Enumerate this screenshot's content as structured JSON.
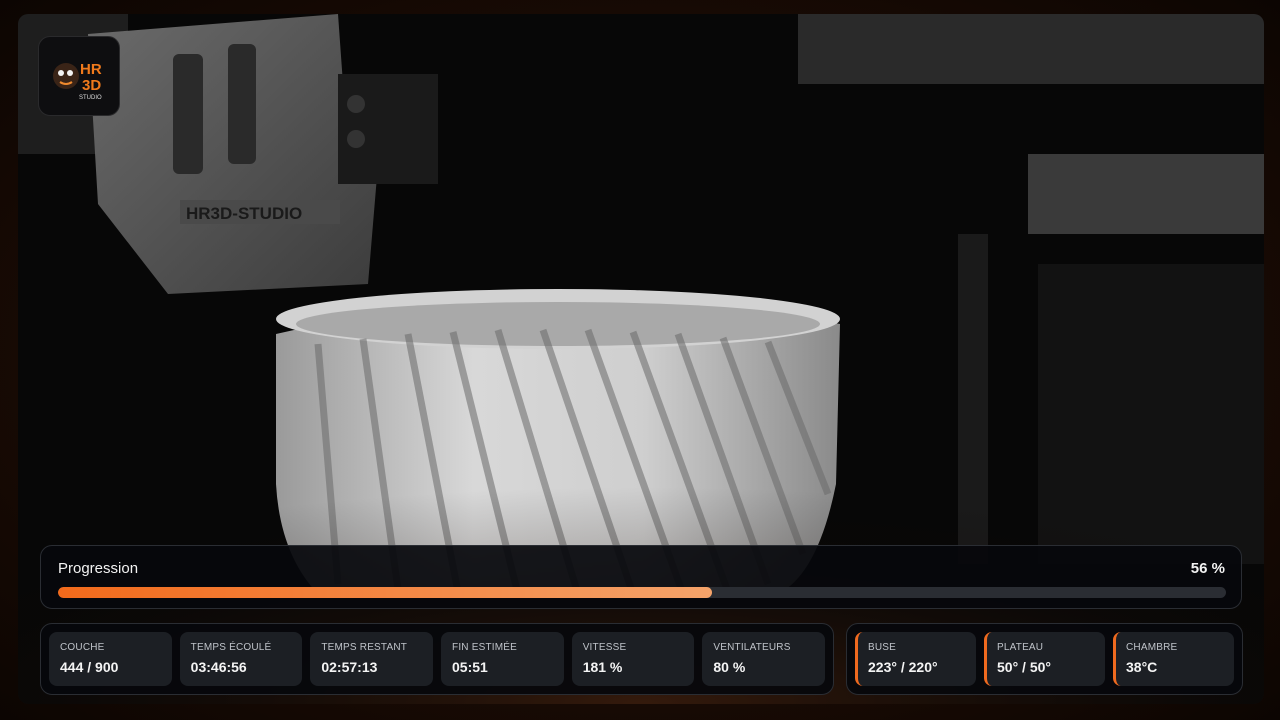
{
  "logo": {
    "text_top": "HR",
    "text_bottom": "3D",
    "subtext": "STUDIO"
  },
  "camera": {
    "printhead_label": "HR3D-STUDIO"
  },
  "progress": {
    "label": "Progression",
    "percent_text": "56 %",
    "fraction": 0.56
  },
  "stats": [
    {
      "label": "COUCHE",
      "value": "444 / 900"
    },
    {
      "label": "TEMPS ÉCOULÉ",
      "value": "03:46:56"
    },
    {
      "label": "TEMPS RESTANT",
      "value": "02:57:13"
    },
    {
      "label": "FIN ESTIMÉE",
      "value": "05:51"
    },
    {
      "label": "VITESSE",
      "value": "181 %"
    },
    {
      "label": "VENTILATEURS",
      "value": "80 %"
    }
  ],
  "temps": [
    {
      "label": "BUSE",
      "value": "223° / 220°"
    },
    {
      "label": "PLATEAU",
      "value": "50° / 50°"
    },
    {
      "label": "CHAMBRE",
      "value": "38°C"
    }
  ],
  "colors": {
    "accent": "#ef6a1f",
    "accent_light": "#f5a36a",
    "panel_bg": "#06080c",
    "card_bg": "#1c1f24"
  }
}
